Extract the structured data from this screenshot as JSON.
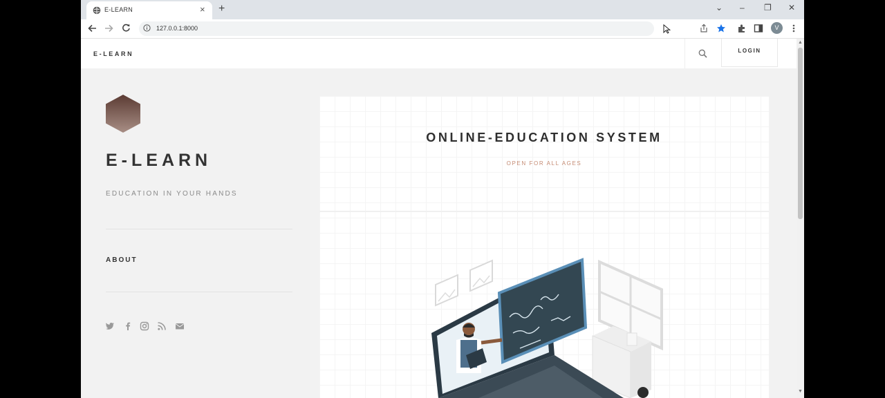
{
  "browser": {
    "tab_title": "E-LEARN",
    "tab_close": "×",
    "new_tab": "+",
    "url": "127.0.0.1:8000",
    "avatar_letter": "V",
    "window_controls": [
      "⌄",
      "–",
      "❐",
      "✕"
    ],
    "nav_icons": [
      "back-arrow-icon",
      "forward-arrow-icon",
      "reload-icon"
    ],
    "toolbar_icons": [
      "share-icon",
      "star-icon",
      "extensions-icon",
      "sidepanel-icon",
      "kebab-menu-icon"
    ],
    "accent": "#1a73e8"
  },
  "site": {
    "nav_logo": "E-LEARN",
    "login": "LOGIN",
    "brand": "E-LEARN",
    "tagline": "EDUCATION IN YOUR HANDS",
    "about": "ABOUT",
    "social_icons": [
      "twitter-icon",
      "facebook-icon",
      "instagram-icon",
      "rss-icon",
      "mail-icon"
    ],
    "hero": {
      "title": "ONLINE-EDUCATION SYSTEM",
      "subtitle": "OPEN FOR ALL AGES"
    },
    "colors": {
      "hex_logo_top": "#5b3b33",
      "hex_logo_bottom": "#a88e85",
      "tagline_accent": "#c0846e"
    }
  }
}
